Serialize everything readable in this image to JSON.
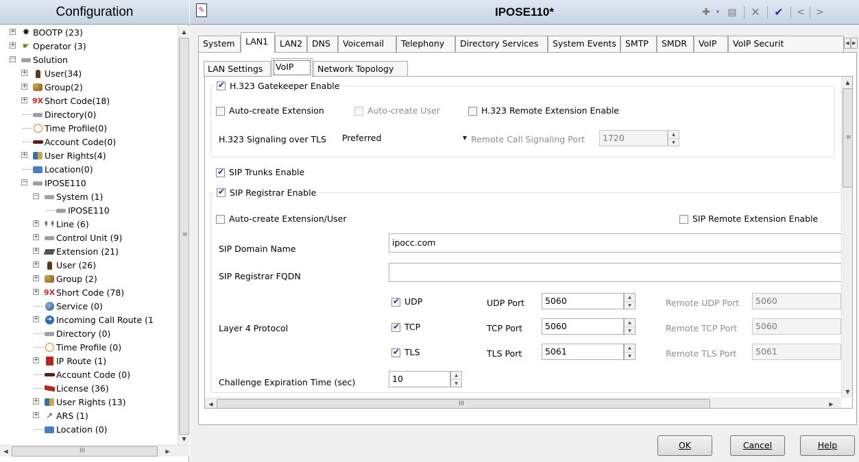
{
  "left_panel": {
    "title": "Configuration",
    "tree": [
      {
        "label": "BOOTP (23)",
        "icon": "bootp-icon",
        "expander": "+"
      },
      {
        "label": "Operator (3)",
        "icon": "operator-icon",
        "expander": "+"
      },
      {
        "label": "Solution",
        "icon": "solution-icon",
        "expander": "-"
      },
      {
        "label": "User(34)",
        "icon": "user-icon",
        "expander": "+"
      },
      {
        "label": "Group(2)",
        "icon": "group-icon",
        "expander": "+"
      },
      {
        "label": "Short Code(18)",
        "icon": "short-code-icon",
        "expander": "+"
      },
      {
        "label": "Directory(0)",
        "icon": "directory-icon",
        "expander": ""
      },
      {
        "label": "Time Profile(0)",
        "icon": "time-profile-icon",
        "expander": ""
      },
      {
        "label": "Account Code(0)",
        "icon": "account-code-icon",
        "expander": ""
      },
      {
        "label": "User Rights(4)",
        "icon": "user-rights-icon",
        "expander": "+"
      },
      {
        "label": "Location(0)",
        "icon": "location-icon",
        "expander": ""
      },
      {
        "label": "IPOSE110",
        "icon": "system-node-icon",
        "expander": "-"
      },
      {
        "label": "System (1)",
        "icon": "system-icon",
        "expander": "-"
      },
      {
        "label": "IPOSE110",
        "icon": "system-icon",
        "expander": ""
      },
      {
        "label": "Line (6)",
        "icon": "line-icon",
        "expander": "+"
      },
      {
        "label": "Control Unit (9)",
        "icon": "control-unit-icon",
        "expander": "+"
      },
      {
        "label": "Extension (21)",
        "icon": "extension-icon",
        "expander": "+"
      },
      {
        "label": "User (26)",
        "icon": "user-icon",
        "expander": "+"
      },
      {
        "label": "Group (2)",
        "icon": "group-icon",
        "expander": "+"
      },
      {
        "label": "Short Code (78)",
        "icon": "short-code-icon",
        "expander": "+"
      },
      {
        "label": "Service (0)",
        "icon": "service-icon",
        "expander": ""
      },
      {
        "label": "Incoming Call Route (1",
        "icon": "incoming-call-route-icon",
        "expander": "+"
      },
      {
        "label": "Directory (0)",
        "icon": "directory-icon",
        "expander": ""
      },
      {
        "label": "Time Profile (0)",
        "icon": "time-profile-icon",
        "expander": ""
      },
      {
        "label": "IP Route (1)",
        "icon": "ip-route-icon",
        "expander": "+"
      },
      {
        "label": "Account Code (0)",
        "icon": "account-code-icon",
        "expander": ""
      },
      {
        "label": "License (36)",
        "icon": "license-icon",
        "expander": ""
      },
      {
        "label": "User Rights (13)",
        "icon": "user-rights-icon",
        "expander": "+"
      },
      {
        "label": "ARS (1)",
        "icon": "ars-icon",
        "expander": "+"
      },
      {
        "label": "Location (0)",
        "icon": "location-icon",
        "expander": ""
      }
    ],
    "scrollbar_grip": "III"
  },
  "window": {
    "title": "IPOSE110*",
    "toolbar_icons": [
      "new-record-icon",
      "save-icon",
      "delete-icon",
      "validate-check-icon",
      "previous-icon",
      "next-icon"
    ]
  },
  "main_tabs": [
    "System",
    "LAN1",
    "LAN2",
    "DNS",
    "Voicemail",
    "Telephony",
    "Directory Services",
    "System Events",
    "SMTP",
    "SMDR",
    "VoIP",
    "VoIP Securit"
  ],
  "active_main_tab": "LAN1",
  "sub_tabs": [
    "LAN Settings",
    "VoIP",
    "Network Topology"
  ],
  "active_sub_tab": "VoIP",
  "voip": {
    "h323_gatekeeper_enable": {
      "label": "H.323 Gatekeeper Enable",
      "checked": true
    },
    "auto_create_extension": {
      "label": "Auto-create Extension",
      "checked": false
    },
    "auto_create_user": {
      "label": "Auto-create User",
      "checked": false,
      "disabled": true
    },
    "h323_remote_extension_enable": {
      "label": "H.323 Remote Extension Enable",
      "checked": false
    },
    "h323_signaling_over_tls": {
      "label": "H.323 Signaling over TLS",
      "value": "Preferred"
    },
    "remote_call_signaling_port": {
      "label": "Remote Call Signaling Port",
      "value": "1720",
      "disabled": true
    },
    "sip_trunks_enable": {
      "label": "SIP Trunks Enable",
      "checked": true
    },
    "sip_registrar_enable": {
      "label": "SIP Registrar Enable",
      "checked": true
    },
    "auto_create_extension_user": {
      "label": "Auto-create Extension/User",
      "checked": false
    },
    "sip_remote_extension_enable": {
      "label": "SIP Remote Extension Enable",
      "checked": false
    },
    "sip_domain_name": {
      "label": "SIP Domain Name",
      "value": "ipocc.com"
    },
    "sip_registrar_fqdn": {
      "label": "SIP Registrar FQDN",
      "value": ""
    },
    "layer4_protocol": {
      "label": "Layer 4 Protocol",
      "udp": {
        "label": "UDP",
        "checked": true,
        "port_label": "UDP Port",
        "port": "5060",
        "remote_label": "Remote UDP Port",
        "remote_port": "5060"
      },
      "tcp": {
        "label": "TCP",
        "checked": true,
        "port_label": "TCP Port",
        "port": "5060",
        "remote_label": "Remote TCP Port",
        "remote_port": "5060"
      },
      "tls": {
        "label": "TLS",
        "checked": true,
        "port_label": "TLS Port",
        "port": "5061",
        "remote_label": "Remote TLS Port",
        "remote_port": "5061"
      }
    },
    "challenge_expiration_time": {
      "label": "Challenge Expiration Time (sec)",
      "value": "10"
    }
  },
  "inner_scrollbar_grip": "III",
  "buttons": {
    "ok": "OK",
    "cancel": "Cancel",
    "help": "Help"
  },
  "colors": {
    "header_gradient_top": "#dfe7f2",
    "header_gradient_bottom": "#c8d4e4",
    "check_color": "#1d3a7c"
  }
}
